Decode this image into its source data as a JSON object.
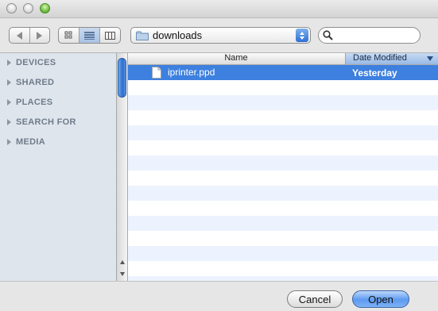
{
  "toolbar": {
    "location": "downloads",
    "search_value": ""
  },
  "sidebar": {
    "sections": [
      {
        "label": "DEVICES"
      },
      {
        "label": "SHARED"
      },
      {
        "label": "PLACES"
      },
      {
        "label": "SEARCH FOR"
      },
      {
        "label": "MEDIA"
      }
    ]
  },
  "filelist": {
    "columns": {
      "name": "Name",
      "date": "Date Modified"
    },
    "sorted_by": "Date Modified",
    "files": [
      {
        "name": "iprinter.ppd",
        "date": "Yesterday",
        "selected": true
      }
    ]
  },
  "buttons": {
    "cancel": "Cancel",
    "open": "Open"
  },
  "colors": {
    "selection": "#3d80df",
    "alt_row": "#edf3fe",
    "sidebar_bg": "#dfe5ec",
    "accent": "#5d9af0"
  },
  "icons": [
    "close-light",
    "minimize-light",
    "zoom-light",
    "back-arrow-icon",
    "forward-arrow-icon",
    "icon-view-icon",
    "list-view-icon",
    "column-view-icon",
    "folder-icon",
    "popup-stepper-icon",
    "search-icon",
    "disclosure-triangle-icon",
    "document-icon",
    "sort-descending-icon"
  ]
}
